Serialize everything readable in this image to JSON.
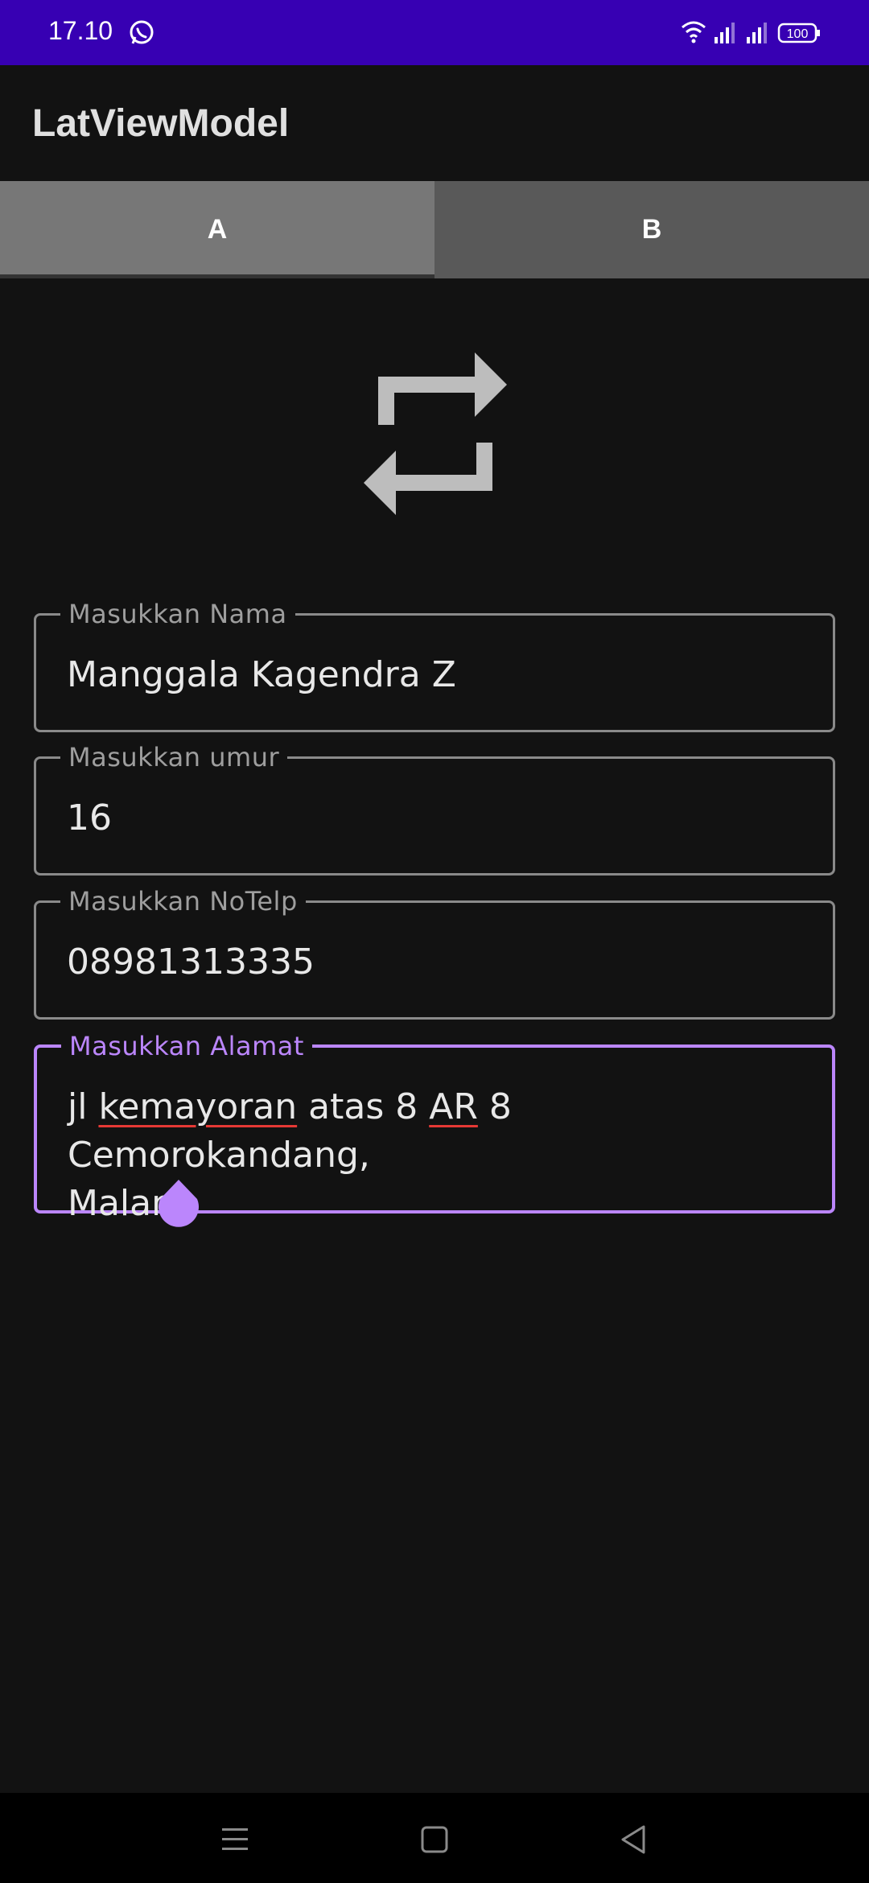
{
  "status_bar": {
    "time": "17.10",
    "battery": "100",
    "background_color": "#3700b3"
  },
  "app_bar": {
    "title": "LatViewModel"
  },
  "tabs": [
    {
      "label": "A",
      "selected": true
    },
    {
      "label": "B",
      "selected": false
    }
  ],
  "header_icon": "swap-arrows-icon",
  "form": {
    "nama": {
      "label": "Masukkan Nama",
      "value": "Manggala Kagendra Z"
    },
    "umur": {
      "label": "Masukkan umur",
      "value": "16"
    },
    "notelp": {
      "label": "Masukkan NoTelp",
      "value": "08981313335"
    },
    "alamat": {
      "label": "Masukkan Alamat",
      "value_parts": [
        "jl ",
        "kemayoran",
        " atas 8 ",
        "AR",
        " 8 Cemorokandang,",
        "Malang"
      ],
      "focused": true
    }
  },
  "colors": {
    "accent": "#bb86fc",
    "background": "#121212",
    "tab_selected": "#777777",
    "tab_unselected": "#595959"
  },
  "nav_bar": {
    "buttons": [
      "menu-icon",
      "home-icon",
      "back-icon"
    ]
  }
}
